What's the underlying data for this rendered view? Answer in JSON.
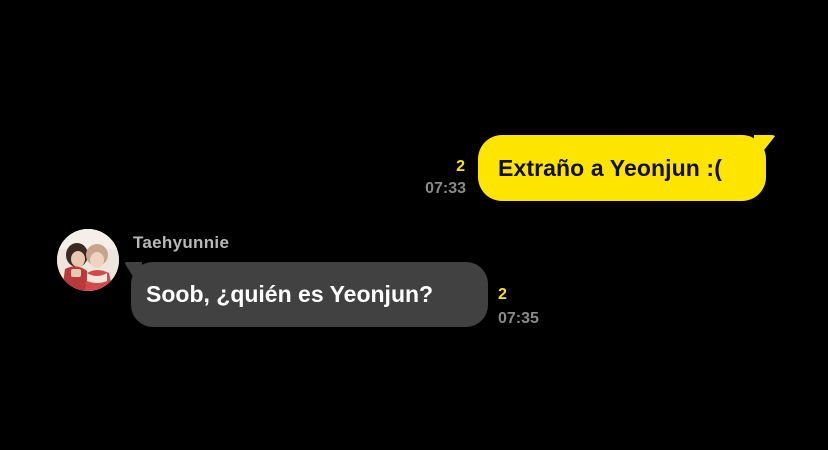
{
  "colors": {
    "background": "#000000",
    "outgoing_bubble": "#FEE500",
    "incoming_bubble": "#414141",
    "unread_count": "#FEE500",
    "timestamp": "#8A8A8A"
  },
  "messages": [
    {
      "direction": "outgoing",
      "text": "Extraño a Yeonjun :(",
      "unread": "2",
      "time": "07:33"
    },
    {
      "direction": "incoming",
      "sender": "Taehyunnie",
      "avatar_icon": "profile-photo-avatar",
      "text": "Soob, ¿quién es Yeonjun?",
      "unread": "2",
      "time": "07:35"
    }
  ]
}
